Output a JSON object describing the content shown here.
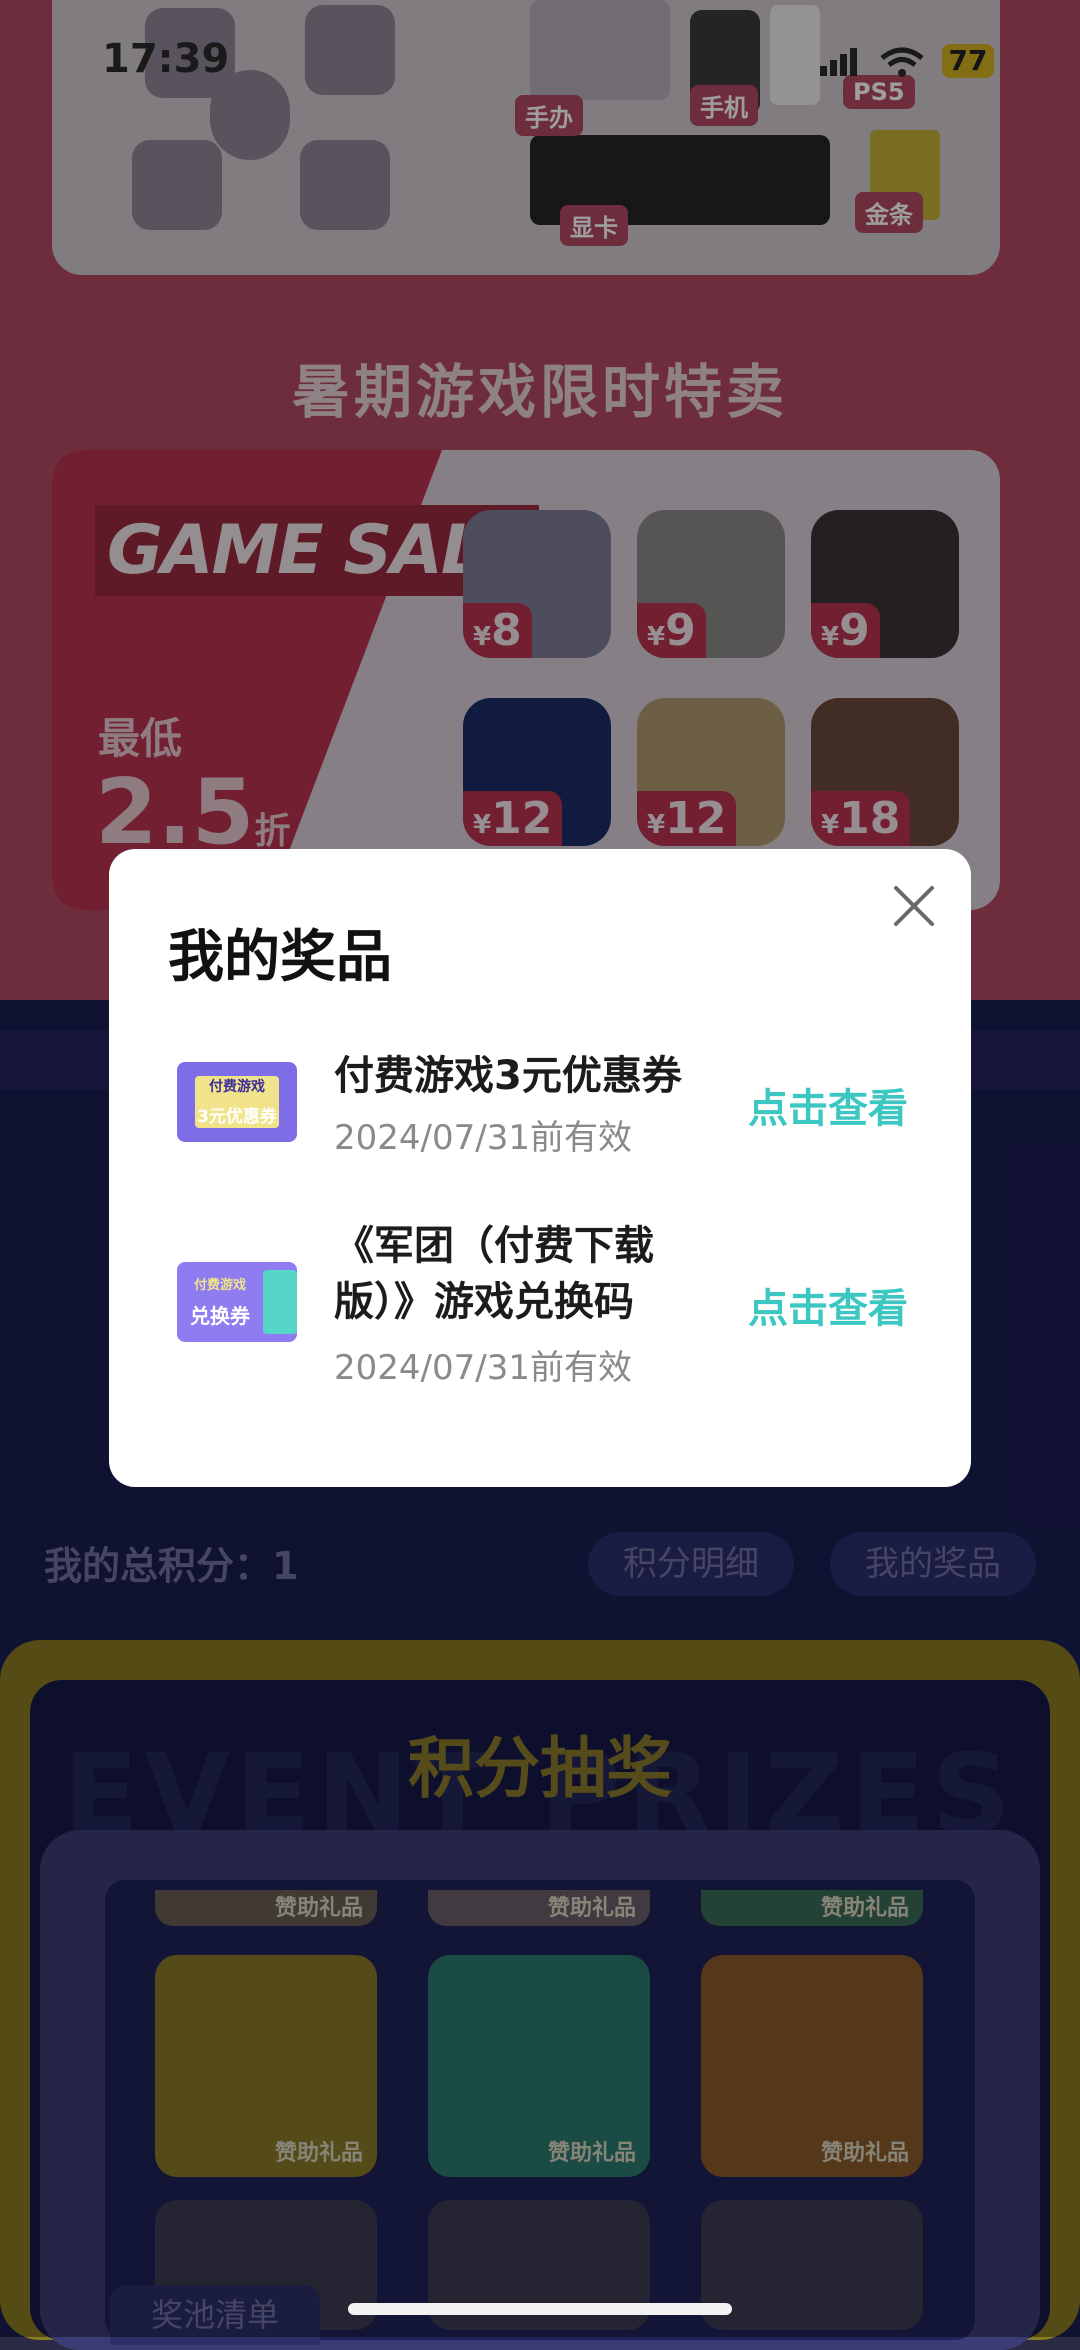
{
  "status_bar": {
    "time": "17:39",
    "battery": "77"
  },
  "background": {
    "prize_labels": [
      "手办",
      "手机",
      "PS5",
      "显卡",
      "金条"
    ],
    "section_title": "暑期游戏限时特卖",
    "sale": {
      "logo": "GAME SALE",
      "min_label": "最低",
      "min_rate": "2.5",
      "rate_unit": "折",
      "prices": [
        "8",
        "9",
        "9",
        "12",
        "12",
        "18"
      ],
      "currency": "¥"
    },
    "points_label": "我的总积分：1",
    "points_detail_btn": "积分明细",
    "my_prizes_btn": "我的奖品",
    "lottery_title": "积分抽奖",
    "lottery_bg_text": "EVENT PRIZES",
    "slot_label": "赞助礼品",
    "pool_tab": "奖池清单"
  },
  "modal": {
    "title": "我的奖品",
    "items": [
      {
        "coupon_top": "付费游戏",
        "coupon_main": "3元优惠券",
        "name_line1": "付费游戏3元优惠券",
        "name_line2": "",
        "date": "2024/07/31前有效",
        "action": "点击查看"
      },
      {
        "coupon_top": "付费游戏",
        "coupon_main": "兑换券",
        "name_line1": "《军团（付费下载",
        "name_line2": "版）》游戏兑换码",
        "date": "2024/07/31前有效",
        "action": "点击查看"
      }
    ]
  },
  "colors": {
    "accent": "#3cc7c2",
    "sale_red": "#b8334f",
    "coupon_purple": "#7d6ee8"
  }
}
